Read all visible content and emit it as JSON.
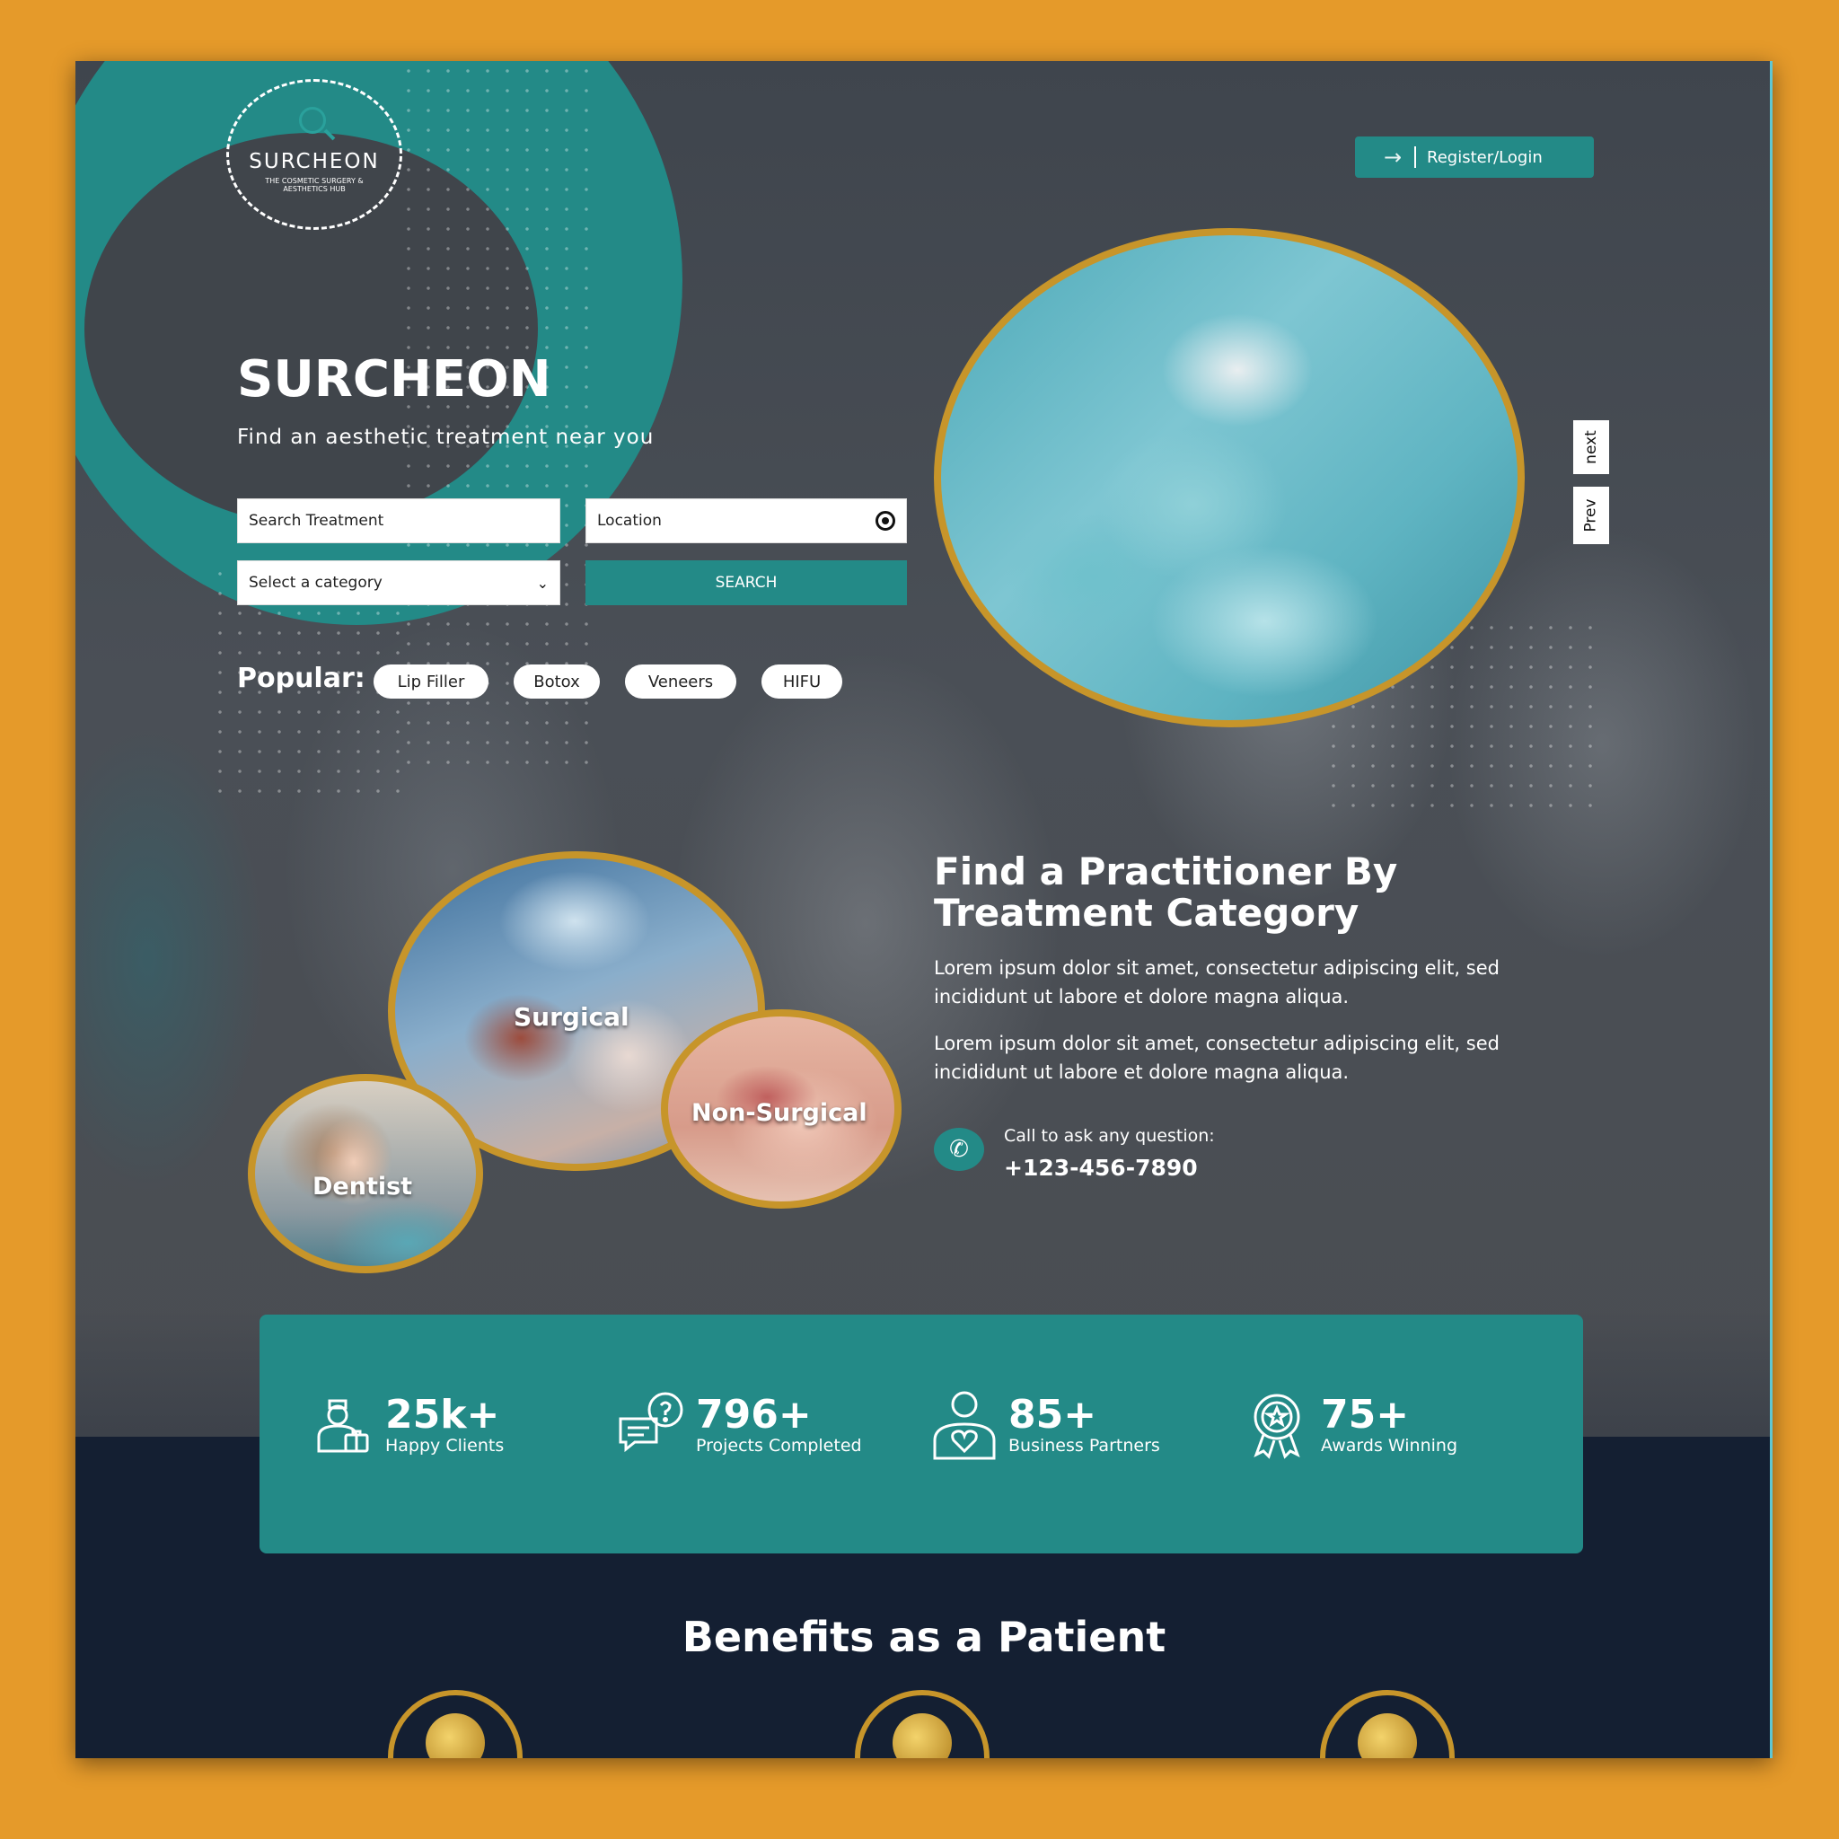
{
  "brand": {
    "logo_name": "SURCHEON",
    "logo_tagline": "THE COSMETIC SURGERY & AESTHETICS HUB",
    "accent": "#238a87",
    "gold": "#c7952a"
  },
  "header": {
    "register_label": "Register/Login",
    "register_icon": "arrow-right-icon"
  },
  "hero": {
    "title": "SURCHEON",
    "subtitle": "Find an aesthetic treatment near you",
    "search": {
      "treatment_value": "Search Treatment",
      "location_value": "Location",
      "location_icon": "locate-icon",
      "category_value": "Select a category",
      "button_label": "SEARCH"
    },
    "popular_label": "Popular:",
    "popular_tags": [
      "Lip Filler",
      "Botox",
      "Veneers",
      "HIFU"
    ],
    "carousel": {
      "next_label": "next",
      "prev_label": "Prev"
    }
  },
  "categories": {
    "items": [
      "Surgical",
      "Non-Surgical",
      "Dentist"
    ]
  },
  "practitioner": {
    "title": "Find a Practitioner By Treatment Category",
    "paragraphs": [
      "Lorem ipsum dolor sit amet, consectetur adipiscing elit, sed incididunt ut labore et dolore magna aliqua.",
      "Lorem ipsum dolor sit amet, consectetur adipiscing elit, sed incididunt ut labore et dolore magna aliqua."
    ],
    "call_label": "Call to ask any question:",
    "call_number": "+123-456-7890",
    "call_icon": "phone-icon"
  },
  "stats": [
    {
      "value": "25k+",
      "label": "Happy Clients",
      "icon": "doctor-icon"
    },
    {
      "value": "796+",
      "label": "Projects Completed",
      "icon": "chat-question-icon"
    },
    {
      "value": "85+",
      "label": "Business Partners",
      "icon": "heart-person-icon"
    },
    {
      "value": "75+",
      "label": "Awards Winning",
      "icon": "award-icon"
    }
  ],
  "benefits": {
    "title": "Benefits as a Patient",
    "icons": [
      "magnifier-icon",
      "handshake-icon",
      "lock-icon"
    ]
  }
}
